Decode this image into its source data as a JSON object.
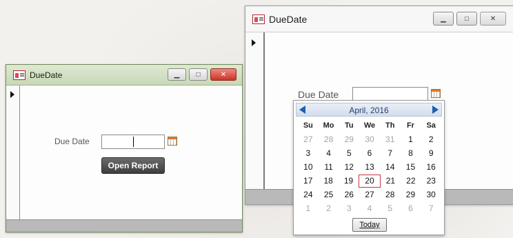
{
  "left_window": {
    "title": "DueDate",
    "controls": {
      "minimize": "▁",
      "maximize": "□",
      "close": "✕"
    },
    "due_date_label": "Due Date",
    "due_date_value": "",
    "open_report_label": "Open Report"
  },
  "right_window": {
    "title": "DueDate",
    "controls": {
      "minimize": "▁",
      "maximize": "□",
      "close": "✕"
    },
    "due_date_label": "Due Date",
    "due_date_value": ""
  },
  "calendar": {
    "month_label": "April, 2016",
    "weekdays": [
      "Su",
      "Mo",
      "Tu",
      "We",
      "Th",
      "Fr",
      "Sa"
    ],
    "weeks": [
      [
        "27",
        "28",
        "29",
        "30",
        "31",
        "1",
        "2"
      ],
      [
        "3",
        "4",
        "5",
        "6",
        "7",
        "8",
        "9"
      ],
      [
        "10",
        "11",
        "12",
        "13",
        "14",
        "15",
        "16"
      ],
      [
        "17",
        "18",
        "19",
        "20",
        "21",
        "22",
        "23"
      ],
      [
        "24",
        "25",
        "26",
        "27",
        "28",
        "29",
        "30"
      ],
      [
        "1",
        "2",
        "3",
        "4",
        "5",
        "6",
        "7"
      ]
    ],
    "today_button_label": "Today",
    "today_day": "20",
    "accent_color": "#1f5fb0",
    "today_outline_color": "#c8343c"
  },
  "icons": {
    "app": "access-form-icon",
    "calendar_picker": "calendar-icon",
    "record_selector": "record-pointer-icon"
  }
}
